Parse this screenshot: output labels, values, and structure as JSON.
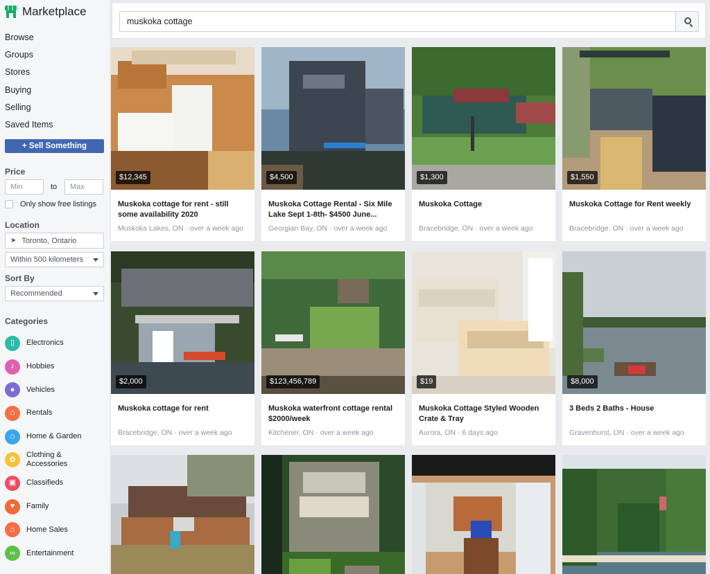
{
  "brand": {
    "title": "Marketplace"
  },
  "nav": [
    "Browse",
    "Groups",
    "Stores",
    "Buying",
    "Selling",
    "Saved Items"
  ],
  "sell_button": "+ Sell Something",
  "price": {
    "heading": "Price",
    "min_placeholder": "Min",
    "to": "to",
    "max_placeholder": "Max",
    "free_label": "Only show free listings"
  },
  "location": {
    "heading": "Location",
    "city": "Toronto, Ontario",
    "radius": "Within 500 kilometers"
  },
  "sort": {
    "heading": "Sort By",
    "value": "Recommended"
  },
  "categories": {
    "heading": "Categories",
    "items": [
      {
        "label": "Electronics",
        "icon": "phone-icon",
        "color": "#2abba7",
        "glyph": "▯"
      },
      {
        "label": "Hobbies",
        "icon": "guitar-icon",
        "color": "#e05fb0",
        "glyph": "♪"
      },
      {
        "label": "Vehicles",
        "icon": "car-icon",
        "color": "#7e6bd8",
        "glyph": "●"
      },
      {
        "label": "Rentals",
        "icon": "key-icon",
        "color": "#f27045",
        "glyph": "⌂"
      },
      {
        "label": "Home & Garden",
        "icon": "house-icon",
        "color": "#3ba7e8",
        "glyph": "⌂"
      },
      {
        "label": "Clothing &\nAccessories",
        "icon": "shirt-icon",
        "color": "#f5c33b",
        "glyph": "✿"
      },
      {
        "label": "Classifieds",
        "icon": "gift-icon",
        "color": "#ee4b62",
        "glyph": "▣"
      },
      {
        "label": "Family",
        "icon": "heart-icon",
        "color": "#f06a3a",
        "glyph": "♥"
      },
      {
        "label": "Home Sales",
        "icon": "home-sale-icon",
        "color": "#f27045",
        "glyph": "⌂"
      },
      {
        "label": "Entertainment",
        "icon": "link-icon",
        "color": "#5fbf4a",
        "glyph": "∞"
      }
    ]
  },
  "search": {
    "value": "muskoka cottage"
  },
  "listings": [
    {
      "price": "$12,345",
      "title": "Muskoka cottage for rent - still some availability 2020",
      "meta": "Muskoka Lakes, ON · over a week ago"
    },
    {
      "price": "$4,500",
      "title": "Muskoka Cottage Rental - Six Mile Lake Sept 1-8th- $4500 June...",
      "meta": "Georgian Bay, ON · over a week ago"
    },
    {
      "price": "$1,300",
      "title": "Muskoka Cottage",
      "meta": "Bracebridge, ON · over a week ago"
    },
    {
      "price": "$1,550",
      "title": "Muskoka Cottage for Rent weekly",
      "meta": "Bracebridge, ON · over a week ago"
    },
    {
      "price": "$2,000",
      "title": "Muskoka cottage for rent",
      "meta": "Bracebridge, ON · over a week ago"
    },
    {
      "price": "$123,456,789",
      "title": "Muskoka waterfront cottage rental $2000/week",
      "meta": "Kitchener, ON · over a week ago"
    },
    {
      "price": "$19",
      "title": "Muskoka Cottage Styled Wooden Crate & Tray",
      "meta": "Aurora, ON · 6 days ago"
    },
    {
      "price": "$8,000",
      "title": "3 Beds 2 Baths - House",
      "meta": "Gravenhurst, ON · over a week ago"
    },
    {
      "price": "",
      "title": "",
      "meta": ""
    },
    {
      "price": "",
      "title": "",
      "meta": ""
    },
    {
      "price": "",
      "title": "",
      "meta": ""
    },
    {
      "price": "",
      "title": "",
      "meta": ""
    }
  ]
}
